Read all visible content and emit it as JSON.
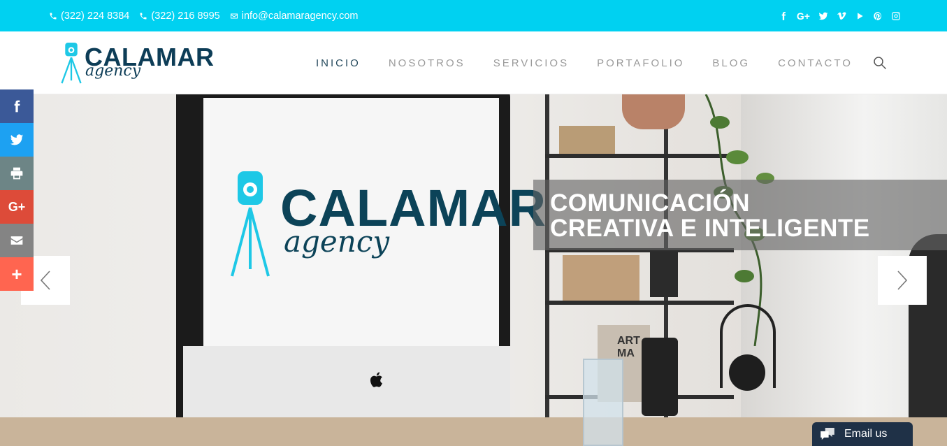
{
  "topbar": {
    "phone1": "(322) 224 8384",
    "phone2": "(322) 216 8995",
    "email": "info@calamaragency.com",
    "socials": [
      "facebook-icon",
      "google-plus-icon",
      "twitter-icon",
      "vimeo-icon",
      "youtube-icon",
      "pinterest-icon",
      "instagram-icon"
    ],
    "google_plus_label": "G+"
  },
  "header": {
    "logo_main": "CALAMAR",
    "logo_sub": "agency",
    "nav": [
      {
        "label": "INICIO",
        "active": true
      },
      {
        "label": "NOSOTROS",
        "active": false
      },
      {
        "label": "SERVICIOS",
        "active": false
      },
      {
        "label": "PORTAFOLIO",
        "active": false
      },
      {
        "label": "BLOG",
        "active": false
      },
      {
        "label": "CONTACTO",
        "active": false
      }
    ]
  },
  "hero": {
    "screen_logo_main": "CALAMAR",
    "screen_logo_sub": "agency",
    "caption_line1": "COMUNICACIÓN",
    "caption_line2": "CREATIVA E INTELIGENTE",
    "book_text": "ART MA"
  },
  "share": {
    "buttons": [
      {
        "name": "facebook",
        "color": "#3b5998"
      },
      {
        "name": "twitter",
        "color": "#1da1f2"
      },
      {
        "name": "print",
        "color": "#6d8586"
      },
      {
        "name": "google-plus",
        "color": "#dd4b39",
        "label": "G+"
      },
      {
        "name": "email",
        "color": "#848484"
      },
      {
        "name": "more",
        "color": "#ff6550",
        "label": "+"
      }
    ]
  },
  "email_widget": {
    "label": "Email us"
  },
  "colors": {
    "topbar": "#00d1f1",
    "brand_dark": "#0d3d57",
    "accent_cyan": "#1ec8e6"
  }
}
